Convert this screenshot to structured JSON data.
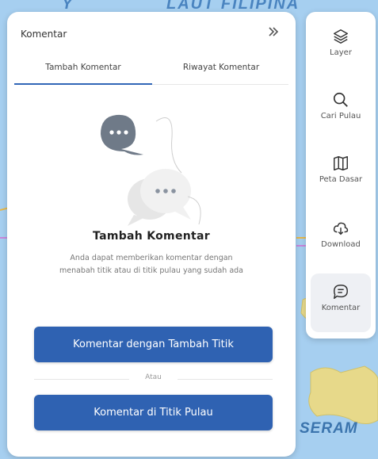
{
  "map": {
    "label_top_a": "Y",
    "label_top_b": "LAUT FILIPINA",
    "label_seram": "SERAM"
  },
  "panel": {
    "title": "Komentar",
    "collapse_icon": "double-chevron-right-icon",
    "tabs": [
      {
        "label": "Tambah Komentar",
        "active": true
      },
      {
        "label": "Riwayat Komentar",
        "active": false
      }
    ],
    "empty": {
      "title": "Tambah Komentar",
      "description": "Anda dapat memberikan komentar dengan menabah titik atau di titik pulau yang sudah ada"
    },
    "buttons": {
      "add_point": "Komentar dengan Tambah Titik",
      "or": "Atau",
      "island_point": "Komentar di Titik Pulau"
    }
  },
  "toolbar": {
    "items": [
      {
        "label": "Layer",
        "icon": "layers-icon",
        "active": false
      },
      {
        "label": "Cari Pulau",
        "icon": "search-icon",
        "active": false
      },
      {
        "label": "Peta Dasar",
        "icon": "map-icon",
        "active": false
      },
      {
        "label": "Download",
        "icon": "cloud-download-icon",
        "active": false
      },
      {
        "label": "Komentar",
        "icon": "comment-icon",
        "active": true
      }
    ]
  },
  "colors": {
    "primary": "#2f62b2",
    "map_water": "#a6cff0",
    "land": "#f1e8a0"
  }
}
